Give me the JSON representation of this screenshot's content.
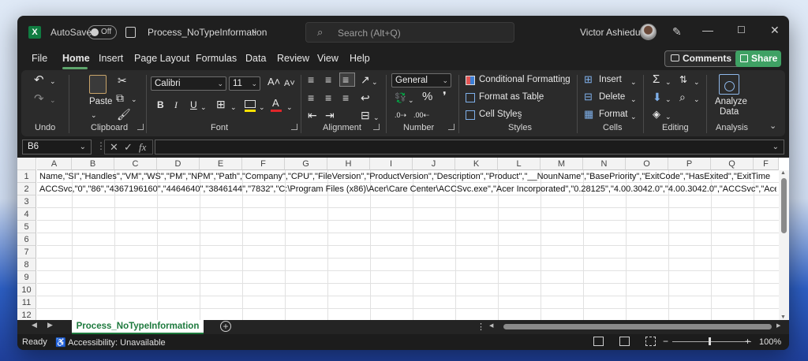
{
  "titlebar": {
    "autosave_label": "AutoSave",
    "autosave_state": "Off",
    "document_title": "Process_NoTypeInformation",
    "search_placeholder": "Search (Alt+Q)",
    "user_name": "Victor Ashiedu"
  },
  "menu": {
    "items": [
      "File",
      "Home",
      "Insert",
      "Page Layout",
      "Formulas",
      "Data",
      "Review",
      "View",
      "Help"
    ],
    "active": "Home",
    "comments_label": "Comments",
    "share_label": "Share"
  },
  "ribbon": {
    "undo_group": "Undo",
    "clipboard": {
      "paste_label": "Paste",
      "group": "Clipboard"
    },
    "font": {
      "name": "Calibri",
      "size": "11",
      "bold": "B",
      "italic": "I",
      "underline": "U",
      "group": "Font"
    },
    "alignment": {
      "group": "Alignment"
    },
    "number": {
      "format": "General",
      "group": "Number"
    },
    "styles": {
      "conditional": "Conditional Formatting",
      "table": "Format as Table",
      "cell_styles": "Cell Styles",
      "group": "Styles"
    },
    "cells": {
      "insert": "Insert",
      "delete": "Delete",
      "format": "Format",
      "group": "Cells"
    },
    "editing": {
      "group": "Editing"
    },
    "analysis": {
      "analyze_line1": "Analyze",
      "analyze_line2": "Data",
      "group": "Analysis"
    }
  },
  "formula_bar": {
    "name_box": "B6",
    "fx": "fx",
    "value": ""
  },
  "grid": {
    "columns": [
      "A",
      "B",
      "C",
      "D",
      "E",
      "F",
      "G",
      "H",
      "I",
      "J",
      "K",
      "L",
      "M",
      "N",
      "O",
      "P",
      "Q",
      "F"
    ],
    "rows": [
      "1",
      "2",
      "3",
      "4",
      "5",
      "6",
      "7",
      "8",
      "9",
      "10",
      "11",
      "12"
    ],
    "cell_a1": "Name,\"SI\",\"Handles\",\"VM\",\"WS\",\"PM\",\"NPM\",\"Path\",\"Company\",\"CPU\",\"FileVersion\",\"ProductVersion\",\"Description\",\"Product\",\"__NounName\",\"BasePriority\",\"ExitCode\",\"HasExited\",\"ExitTime",
    "cell_a2": "ACCSvc,\"0\",\"86\",\"4367196160\",\"4464640\",\"3846144\",\"7832\",\"C:\\Program Files (x86)\\Acer\\Care Center\\ACCSvc.exe\",\"Acer Incorporated\",\"0.28125\",\"4.00.3042.0\",\"4.00.3042.0\",\"ACCSvc\",\"Acer"
  },
  "sheets": {
    "active_tab": "Process_NoTypeInformation"
  },
  "status": {
    "ready": "Ready",
    "accessibility": "Accessibility: Unavailable",
    "zoom": "100%"
  }
}
